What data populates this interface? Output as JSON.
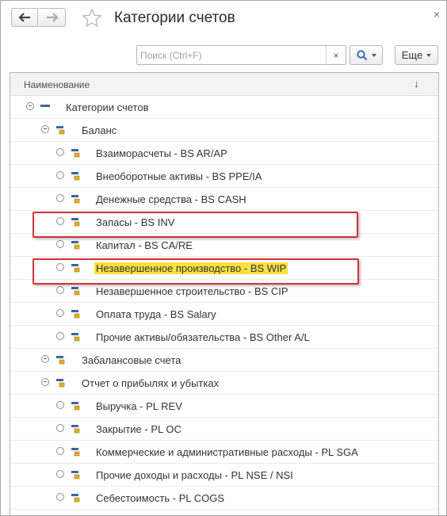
{
  "window": {
    "title": "Категории счетов",
    "close_glyph": "×"
  },
  "nav": {
    "back_icon": "arrow-left-icon",
    "forward_icon": "arrow-right-icon"
  },
  "search": {
    "placeholder": "Поиск (Ctrl+F)",
    "value": "",
    "clear_glyph": "×"
  },
  "toolbar": {
    "more_label": "Еще"
  },
  "table": {
    "column_header": "Наименование",
    "sort_glyph": "↓",
    "rows": [
      {
        "label": "Категории счетов",
        "level": 0,
        "type": "root",
        "expanded": true
      },
      {
        "label": "Баланс",
        "level": 1,
        "type": "group",
        "expanded": true
      },
      {
        "label": "Взаиморасчеты - BS AR/AP",
        "level": 2,
        "type": "item"
      },
      {
        "label": "Внеоборотные активы - BS PPE/IA",
        "level": 2,
        "type": "item"
      },
      {
        "label": "Денежные средства - BS CASH",
        "level": 2,
        "type": "item"
      },
      {
        "label": "Запасы - BS INV",
        "level": 2,
        "type": "item",
        "boxed": true
      },
      {
        "label": "Капитал - BS CA/RE",
        "level": 2,
        "type": "item"
      },
      {
        "label": "Незавершенное производство - BS WIP",
        "level": 2,
        "type": "item",
        "boxed": true,
        "highlighted": true
      },
      {
        "label": "Незавершенное строительство - BS CIP",
        "level": 2,
        "type": "item"
      },
      {
        "label": "Оплата труда - BS Salary",
        "level": 2,
        "type": "item"
      },
      {
        "label": "Прочие активы/обязательства - BS Other A/L",
        "level": 2,
        "type": "item"
      },
      {
        "label": "Забалансовые счета",
        "level": 1,
        "type": "group",
        "expanded": false
      },
      {
        "label": "Отчет о прибылях и убытках",
        "level": 1,
        "type": "group",
        "expanded": true
      },
      {
        "label": "Выручка - PL REV",
        "level": 2,
        "type": "item"
      },
      {
        "label": "Закрытие - PL OC",
        "level": 2,
        "type": "item"
      },
      {
        "label": "Коммерческие и административные расходы - PL SGA",
        "level": 2,
        "type": "item"
      },
      {
        "label": "Прочие доходы и расходы - PL NSE / NSI",
        "level": 2,
        "type": "item"
      },
      {
        "label": "Себестоимость - PL COGS",
        "level": 2,
        "type": "item"
      }
    ]
  },
  "colors": {
    "highlight": "#f8e040",
    "annotation_box": "#d6303a",
    "item_icon_yellow": "#e0b020",
    "item_icon_blue": "#3a64a8"
  }
}
